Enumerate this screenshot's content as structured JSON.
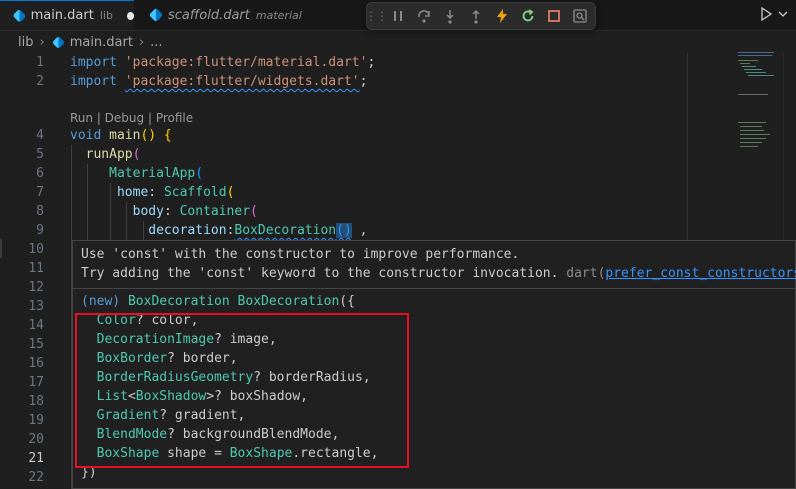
{
  "tabs": [
    {
      "name": "main.dart",
      "desc": "lib",
      "dirty": true
    },
    {
      "name": "scaffold.dart",
      "desc": "material"
    }
  ],
  "breadcrumb": {
    "folder": "lib",
    "file": "main.dart",
    "more": "..."
  },
  "codelens": "Run | Debug | Profile",
  "line_numbers": [
    "1",
    "2",
    "4",
    "5",
    "6",
    "7",
    "8",
    "9",
    "10",
    "11",
    "12",
    "13",
    "14",
    "15",
    "16",
    "17",
    "18",
    "19",
    "20",
    "21",
    "22"
  ],
  "current_line": "21",
  "code": {
    "l1_kw": "import",
    "l1_str": "'package:flutter/material.dart'",
    "l1_end": ";",
    "l2_kw": "import",
    "l2_str": "'package:flutter/widgets.dart'",
    "l2_end": ";",
    "l4_kw": "void",
    "l4_fn": "main",
    "l4_rest": "() {",
    "l5_fn": "runApp",
    "l5_rest": "(",
    "l6_cls": "MaterialApp",
    "l6_rest": "(",
    "l7_par": "home",
    "l7_colon": ": ",
    "l7_cls": "Scaffold",
    "l7_rest": "(",
    "l8_par": "body",
    "l8_colon": ": ",
    "l8_cls": "Container",
    "l8_rest": "(",
    "l9_par": "decoration",
    "l9_colon": ":",
    "l9_cls": "BoxDecoration",
    "l9_parens": "()",
    "l9_rest": " ,"
  },
  "hover": {
    "line1": "Use 'const' with the constructor to improve performance.",
    "line2_text": "Try adding the 'const' keyword to the constructor invocation.",
    "line2_source": "dart",
    "line2_link": "prefer_const_constructors",
    "sig_prefix": "(new) ",
    "sig_class": "BoxDecoration",
    "sig_space": " ",
    "sig_ctor": "BoxDecoration",
    "sig_open": "({",
    "params": [
      {
        "type": "Color",
        "rest": "? color,"
      },
      {
        "type": "DecorationImage",
        "rest": "? image,"
      },
      {
        "type": "BoxBorder",
        "rest": "? border,"
      },
      {
        "type": "BorderRadiusGeometry",
        "rest": "? borderRadius,"
      },
      {
        "type": "List",
        "generic_open": "<",
        "generic": "BoxShadow",
        "rest": ">? boxShadow,"
      },
      {
        "type": "Gradient",
        "rest": "? gradient,"
      },
      {
        "type": "BlendMode",
        "rest": "? backgroundBlendMode,"
      },
      {
        "type": "BoxShape",
        "rest": " shape = ",
        "default_cls": "BoxShape",
        "default_rest": ".rectangle,"
      }
    ],
    "sig_close": "})"
  },
  "colors": {
    "keyword": "#569cd6",
    "string": "#ce9178",
    "type": "#4ec9b0",
    "function": "#dcdcaa",
    "param": "#9cdcfe",
    "highlight_box": "#e81123"
  }
}
